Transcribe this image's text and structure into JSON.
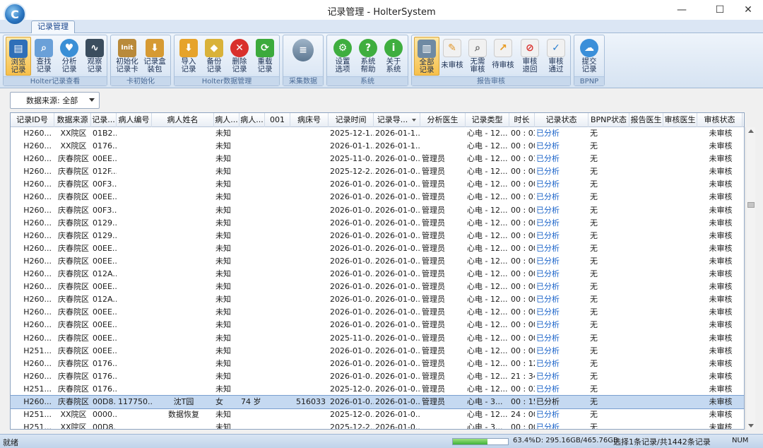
{
  "window": {
    "title": "记录管理 - HolterSystem",
    "minimize": "—",
    "maximize": "☐",
    "close": "✕"
  },
  "ribbon": {
    "tab": "记录管理",
    "groups": [
      {
        "label": "Holter记录查看",
        "buttons": [
          "浏览\n记录",
          "查找\n记录",
          "分析\n记录",
          "观察\n记录"
        ]
      },
      {
        "label": "卡初始化",
        "buttons": [
          "初始化\n记录卡",
          "记录盒\n装包"
        ]
      },
      {
        "label": "Holter数据管理",
        "buttons": [
          "导入\n记录",
          "备份\n记录",
          "删除\n记录",
          "重载\n记录"
        ]
      },
      {
        "label": "采集数据",
        "buttons": [
          ""
        ]
      },
      {
        "label": "系统",
        "buttons": [
          "设置\n选项",
          "系统\n帮助",
          "关于\n系统"
        ]
      },
      {
        "label": "报告审核",
        "buttons": [
          "全部\n记录",
          "未审核",
          "无需\n审核",
          "待审核",
          "审核\n退回",
          "审核\n通过"
        ]
      },
      {
        "label": "BPNP",
        "buttons": [
          "提交\n记录"
        ]
      }
    ]
  },
  "filter": {
    "label": "数据来源: 全部"
  },
  "grid": {
    "columns": [
      "记录ID号",
      "数据来源",
      "记录...",
      "病人编号",
      "病人姓名",
      "病人...",
      "病人...",
      "001",
      "病床号",
      "记录时间",
      "记录导...",
      "分析医生",
      "记录类型",
      "时长",
      "记录状态",
      "BPNP状态",
      "报告医生",
      "审核医生",
      "审核状态"
    ],
    "rows": [
      [
        "H260...",
        "XX院区",
        "01B2...",
        "",
        "",
        "未知",
        "",
        "",
        "",
        "2025-12-1...",
        "2026-01-1...",
        "",
        "心电 - 12...",
        "00 : 03",
        "已分析",
        "无",
        "",
        "",
        "未审核"
      ],
      [
        "H260...",
        "XX院区",
        "0176...",
        "",
        "",
        "未知",
        "",
        "",
        "",
        "2026-01-1...",
        "2026-01-1...",
        "",
        "心电 - 12...",
        "00 : 00",
        "已分析",
        "无",
        "",
        "",
        "未审核"
      ],
      [
        "H260...",
        "庆春院区",
        "00EE...",
        "",
        "",
        "未知",
        "",
        "",
        "",
        "2025-11-0...",
        "2026-01-0...",
        "管理员",
        "心电 - 12...",
        "00 : 01",
        "已分析",
        "无",
        "",
        "",
        "未审核"
      ],
      [
        "H260...",
        "庆春院区",
        "012F...",
        "",
        "",
        "未知",
        "",
        "",
        "",
        "2025-12-2...",
        "2026-01-0...",
        "管理员",
        "心电 - 12...",
        "00 : 00",
        "已分析",
        "无",
        "",
        "",
        "未审核"
      ],
      [
        "H260...",
        "庆春院区",
        "00F3...",
        "",
        "",
        "未知",
        "",
        "",
        "",
        "2026-01-0...",
        "2026-01-0...",
        "管理员",
        "心电 - 12...",
        "00 : 00",
        "已分析",
        "无",
        "",
        "",
        "未审核"
      ],
      [
        "H260...",
        "庆春院区",
        "00EE...",
        "",
        "",
        "未知",
        "",
        "",
        "",
        "2026-01-0...",
        "2026-01-0...",
        "管理员",
        "心电 - 12...",
        "00 : 01",
        "已分析",
        "无",
        "",
        "",
        "未审核"
      ],
      [
        "H260...",
        "庆春院区",
        "00F3...",
        "",
        "",
        "未知",
        "",
        "",
        "",
        "2026-01-0...",
        "2026-01-0...",
        "管理员",
        "心电 - 12...",
        "00 : 00",
        "已分析",
        "无",
        "",
        "",
        "未审核"
      ],
      [
        "H260...",
        "庆春院区",
        "0129...",
        "",
        "",
        "未知",
        "",
        "",
        "",
        "2026-01-0...",
        "2026-01-0...",
        "管理员",
        "心电 - 12...",
        "00 : 00",
        "已分析",
        "无",
        "",
        "",
        "未审核"
      ],
      [
        "H260...",
        "庆春院区",
        "0129...",
        "",
        "",
        "未知",
        "",
        "",
        "",
        "2026-01-0...",
        "2026-01-0...",
        "管理员",
        "心电 - 12...",
        "00 : 00",
        "已分析",
        "无",
        "",
        "",
        "未审核"
      ],
      [
        "H260...",
        "庆春院区",
        "00EE...",
        "",
        "",
        "未知",
        "",
        "",
        "",
        "2026-01-0...",
        "2026-01-0...",
        "管理员",
        "心电 - 12...",
        "00 : 00",
        "已分析",
        "无",
        "",
        "",
        "未审核"
      ],
      [
        "H260...",
        "庆春院区",
        "00EE...",
        "",
        "",
        "未知",
        "",
        "",
        "",
        "2026-01-0...",
        "2026-01-0...",
        "管理员",
        "心电 - 12...",
        "00 : 00",
        "已分析",
        "无",
        "",
        "",
        "未审核"
      ],
      [
        "H260...",
        "庆春院区",
        "012A...",
        "",
        "",
        "未知",
        "",
        "",
        "",
        "2026-01-0...",
        "2026-01-0...",
        "管理员",
        "心电 - 12...",
        "00 : 00",
        "已分析",
        "无",
        "",
        "",
        "未审核"
      ],
      [
        "H260...",
        "庆春院区",
        "00EE...",
        "",
        "",
        "未知",
        "",
        "",
        "",
        "2026-01-0...",
        "2026-01-0...",
        "管理员",
        "心电 - 12...",
        "00 : 00",
        "已分析",
        "无",
        "",
        "",
        "未审核"
      ],
      [
        "H260...",
        "庆春院区",
        "012A...",
        "",
        "",
        "未知",
        "",
        "",
        "",
        "2026-01-0...",
        "2026-01-0...",
        "管理员",
        "心电 - 12...",
        "00 : 00",
        "已分析",
        "无",
        "",
        "",
        "未审核"
      ],
      [
        "H260...",
        "庆春院区",
        "00EE...",
        "",
        "",
        "未知",
        "",
        "",
        "",
        "2026-01-0...",
        "2026-01-0...",
        "管理员",
        "心电 - 12...",
        "00 : 00",
        "已分析",
        "无",
        "",
        "",
        "未审核"
      ],
      [
        "H260...",
        "庆春院区",
        "00EE...",
        "",
        "",
        "未知",
        "",
        "",
        "",
        "2026-01-0...",
        "2026-01-0...",
        "管理员",
        "心电 - 12...",
        "00 : 00",
        "已分析",
        "无",
        "",
        "",
        "未审核"
      ],
      [
        "H260...",
        "庆春院区",
        "00EE...",
        "",
        "",
        "未知",
        "",
        "",
        "",
        "2025-11-0...",
        "2026-01-0...",
        "管理员",
        "心电 - 12...",
        "00 : 00",
        "已分析",
        "无",
        "",
        "",
        "未审核"
      ],
      [
        "H251...",
        "庆春院区",
        "00EE...",
        "",
        "",
        "未知",
        "",
        "",
        "",
        "2026-01-0...",
        "2026-01-0...",
        "管理员",
        "心电 - 12...",
        "00 : 00",
        "已分析",
        "无",
        "",
        "",
        "未审核"
      ],
      [
        "H260...",
        "庆春院区",
        "0176...",
        "",
        "",
        "未知",
        "",
        "",
        "",
        "2026-01-0...",
        "2026-01-0...",
        "管理员",
        "心电 - 12...",
        "00 : 12",
        "已分析",
        "无",
        "",
        "",
        "未审核"
      ],
      [
        "H260...",
        "庆春院区",
        "0176...",
        "",
        "",
        "未知",
        "",
        "",
        "",
        "2026-01-0...",
        "2026-01-0...",
        "管理员",
        "心电 - 12...",
        "21 : 34",
        "已分析",
        "无",
        "",
        "",
        "未审核"
      ],
      [
        "H251...",
        "庆春院区",
        "0176...",
        "",
        "",
        "未知",
        "",
        "",
        "",
        "2025-12-0...",
        "2026-01-0...",
        "管理员",
        "心电 - 12...",
        "00 : 03",
        "已分析",
        "无",
        "",
        "",
        "未审核"
      ],
      [
        "H260...",
        "庆春院区",
        "00D8...",
        "117750...",
        "沈T园",
        "女",
        "74 岁",
        "",
        "516033",
        "2026-01-0...",
        "2026-01-0...",
        "管理员",
        "心电 - 3...",
        "00 : 15",
        "已分析",
        "无",
        "",
        "",
        "未审核"
      ],
      [
        "H251...",
        "XX院区",
        "0000...",
        "",
        "数据恢复",
        "未知",
        "",
        "",
        "",
        "2025-12-0...",
        "2026-01-0...",
        "",
        "心电 - 12...",
        "24 : 00",
        "已分析",
        "无",
        "",
        "",
        "未审核"
      ],
      [
        "H251...",
        "XX院区",
        "00D8...",
        "",
        "",
        "未知",
        "",
        "",
        "",
        "2025-12-2...",
        "2026-01-0...",
        "",
        "心电 - 3...",
        "00 : 00",
        "已分析",
        "无",
        "",
        "",
        "未审核"
      ]
    ],
    "selected_row": 21
  },
  "statusbar": {
    "status": "就绪",
    "disk_used_fraction": 0.634,
    "disk_pct": "63.4%",
    "disk_size": "D: 295.16GB/465.76GB",
    "selection": "选择1条记录/共1442条记录",
    "num": "NUM"
  }
}
